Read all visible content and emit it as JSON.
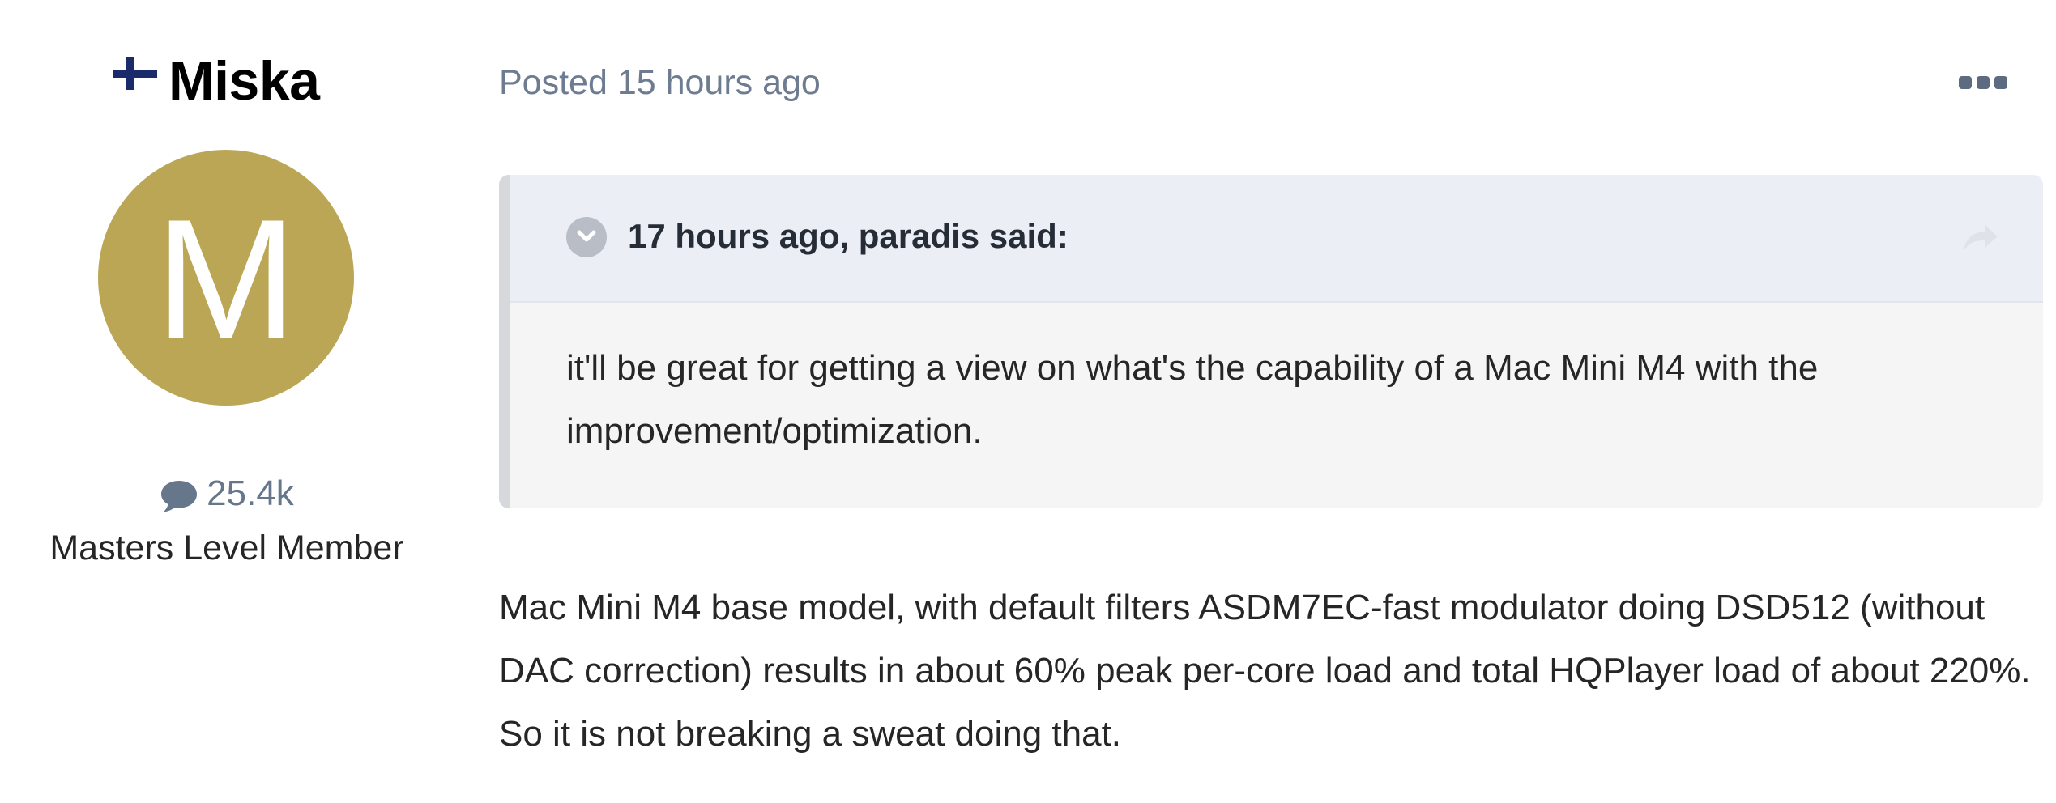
{
  "author": {
    "flag_icon": "finland-flag-icon",
    "name": "Miska",
    "avatar_letter": "M",
    "avatar_color": "#bba656",
    "post_count": "25.4k",
    "title": "Masters Level Member"
  },
  "post": {
    "meta": "Posted 15 hours ago",
    "menu_icon": "more-options-icon",
    "quote": {
      "citation": "17 hours ago, paradis said:",
      "body": "it'll be great for getting a view on what's the capability of a Mac Mini M4 with the improvement/optimization."
    },
    "body": "Mac Mini M4 base model, with default filters ASDM7EC-fast modulator doing DSD512 (without DAC correction) results in about 60% peak per-core load and total HQPlayer load of about 220%. So it is not breaking a sweat doing that."
  }
}
